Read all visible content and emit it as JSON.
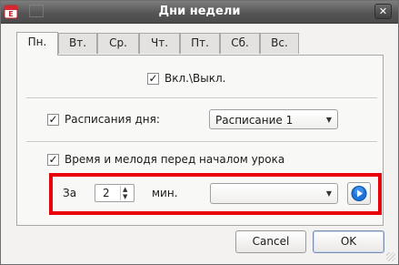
{
  "window": {
    "title": "Дни недели",
    "close_icon": "close-icon",
    "app_icon": "calendar-app-icon"
  },
  "tabs": [
    {
      "label": "Пн.",
      "active": true
    },
    {
      "label": "Вт."
    },
    {
      "label": "Ср."
    },
    {
      "label": "Чт."
    },
    {
      "label": "Пт."
    },
    {
      "label": "Сб."
    },
    {
      "label": "Вс."
    }
  ],
  "panel": {
    "enable": {
      "label": "Вкл.\\Выкл.",
      "checked": true
    },
    "schedule": {
      "label": "Расписания дня:",
      "checked": true,
      "selected": "Расписание 1"
    },
    "melody": {
      "label": "Время и мелодя перед началом урока",
      "checked": true,
      "before_label": "За",
      "minutes_value": "2",
      "minutes_unit": "мин.",
      "melody_selected": ""
    }
  },
  "buttons": {
    "cancel": "Cancel",
    "ok": "OK"
  },
  "colors": {
    "highlight": "#e8000a",
    "play_accent": "#1c73d8"
  }
}
